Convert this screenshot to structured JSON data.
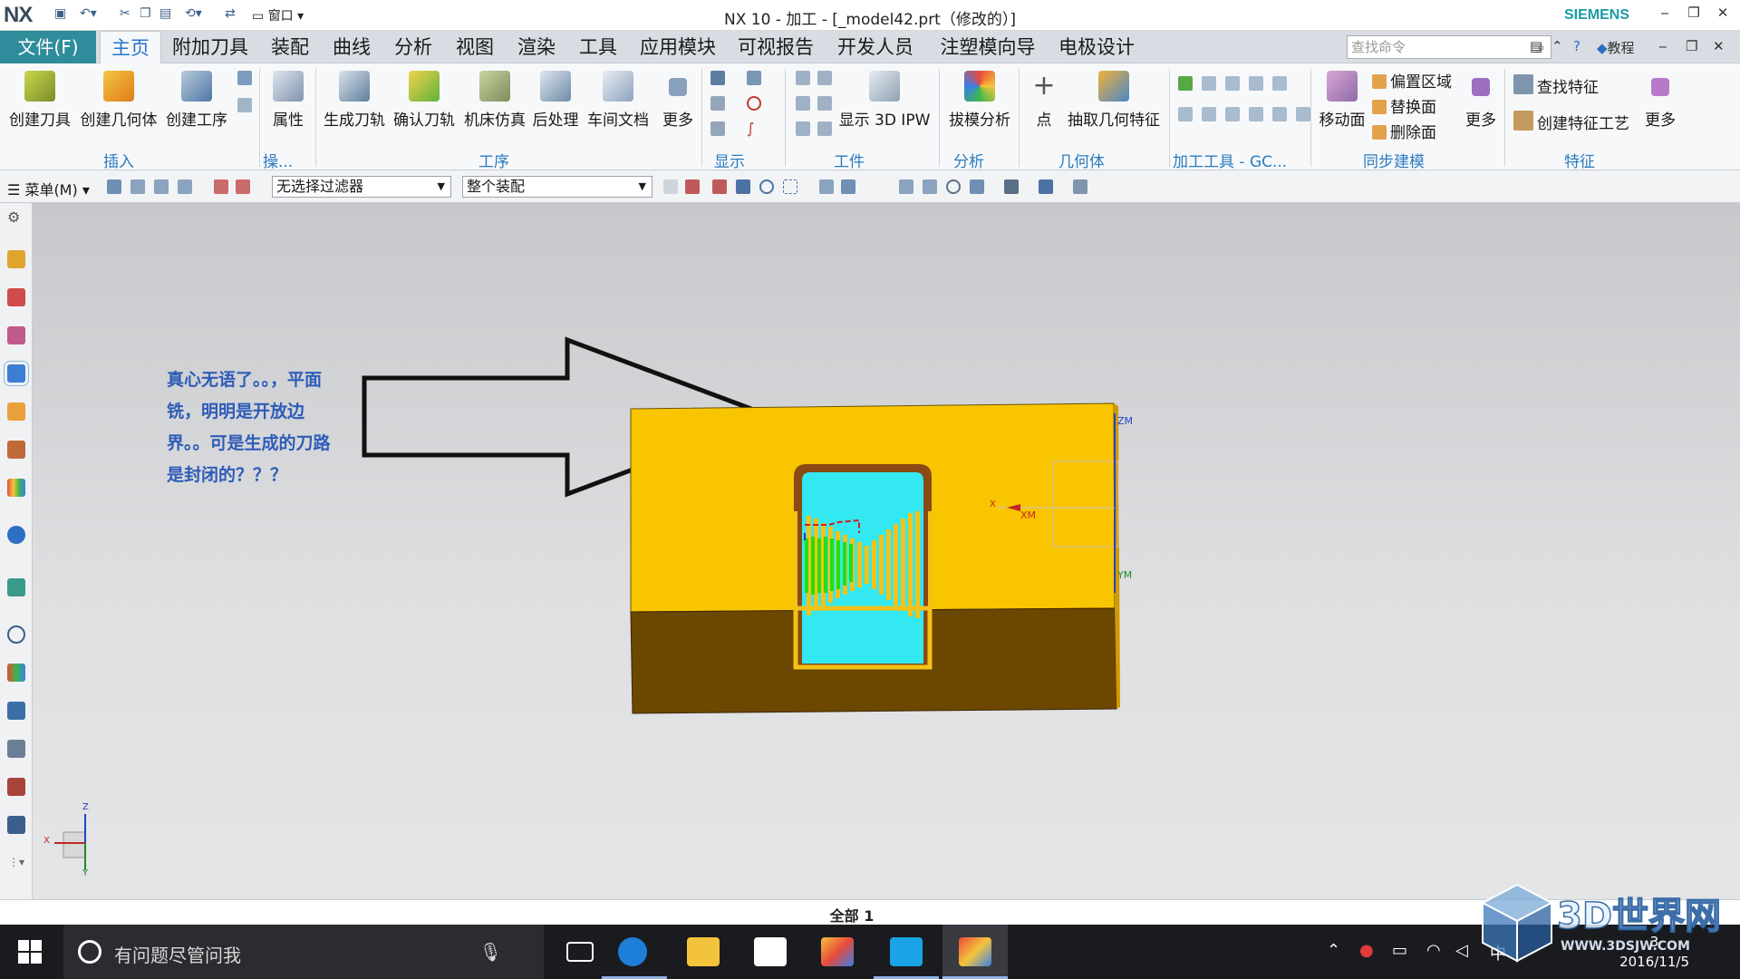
{
  "title_bar": {
    "logo": "NX",
    "window_label": "窗口",
    "title": "NX 10 - 加工 - [_model42.prt（修改的）]",
    "brand": "SIEMENS"
  },
  "menu": {
    "file": "文件(F)",
    "tabs": [
      "主页",
      "附加刀具",
      "装配",
      "曲线",
      "分析",
      "视图",
      "渲染",
      "工具",
      "应用模块",
      "可视报告",
      "开发人员",
      "注塑模向导",
      "电极设计"
    ],
    "active_tab": "主页",
    "search_placeholder": "查找命令",
    "tutorial": "教程"
  },
  "ribbon": {
    "create_tool": "创建刀具",
    "create_geometry": "创建几何体",
    "create_operation": "创建工序",
    "properties": "属性",
    "generate_path": "生成刀轨",
    "verify_path": "确认刀轨",
    "machine_sim": "机床仿真",
    "postprocess": "后处理",
    "shop_doc": "车间文档",
    "more1": "更多",
    "show_3d_ipw": "显示 3D IPW",
    "draft_analysis": "拔模分析",
    "point": "点",
    "extract_geometry": "抽取几何特征",
    "move_face": "移动面",
    "offset_region": "偏置区域",
    "replace_face": "替换面",
    "delete_face": "删除面",
    "more2": "更多",
    "find_feature": "查找特征",
    "create_feature_process": "创建特征工艺",
    "more3": "更多",
    "groups": {
      "insert": "插入",
      "ops": "操...",
      "operation": "工序",
      "display": "显示",
      "workpiece": "工件",
      "analysis": "分析",
      "geometry": "几何体",
      "machining_tools": "加工工具 - GC...",
      "sync_modeling": "同步建模",
      "feature": "特征"
    }
  },
  "toolbar": {
    "menu": "菜单(M)",
    "filter": "无选择过滤器",
    "assembly": "整个装配"
  },
  "viewport": {
    "annotation": [
      "真心无语了。。，平面",
      "铣，明明是开放边",
      "界。。可是生成的刀路",
      "是封闭的？？？"
    ],
    "wcs": {
      "zm": "ZM",
      "xm": "XM",
      "ym": "YM",
      "x": "X"
    },
    "triad": {
      "x": "X",
      "y": "Y",
      "z": "Z"
    },
    "colors": {
      "part_top": "#f9c500",
      "part_bottom": "#6b4700",
      "pocket": "#33e8f0",
      "toolpath": "#f2c218",
      "highlight": "#22e011"
    }
  },
  "status": {
    "text": "全部 1"
  },
  "taskbar": {
    "search_text": "有问题尽管问我",
    "ime": "中",
    "time": "3",
    "date": "2016/11/5"
  },
  "watermark": {
    "text": "3D世界网",
    "url": "WWW.3DSJW.COM"
  }
}
